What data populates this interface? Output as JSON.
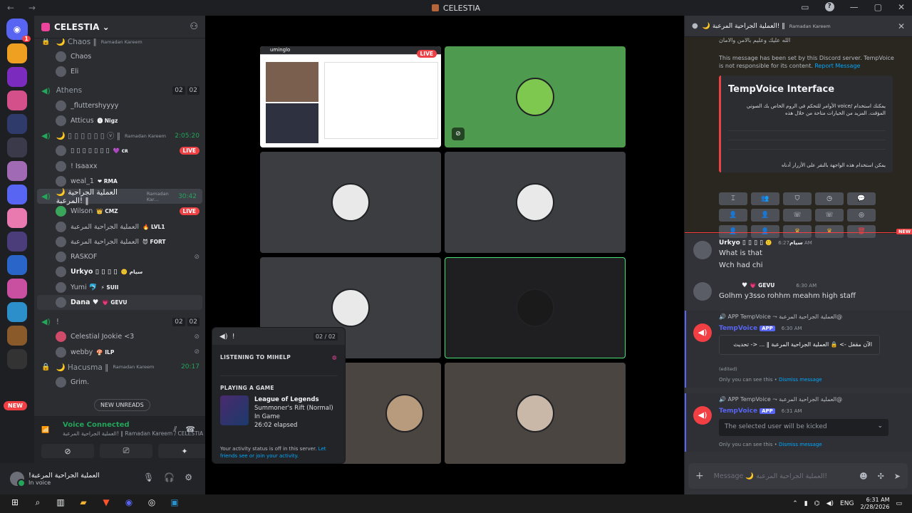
{
  "titlebar": {
    "title": "CELESTIA",
    "nav": "← →"
  },
  "rail": {
    "home_badge": "1",
    "new_label": "NEW"
  },
  "sidebar": {
    "server_name": "CELESTIA ⌄",
    "channels": [
      {
        "name": "🌙 Chaos ‖",
        "sub": "Ramadan Kareem",
        "members": [
          {
            "name": "Chaos",
            "tag": ""
          },
          {
            "name": "Eli",
            "tag": ""
          }
        ]
      },
      {
        "name": "Athens",
        "count": [
          "02",
          "02"
        ],
        "members": [
          {
            "name": "_fluttershyyyy",
            "tag": ""
          },
          {
            "name": "Atticus",
            "tag": "🅨 Nigz"
          }
        ]
      },
      {
        "name": "🌙 ▯ ▯ ▯ ▯ ▯ ▯ ⓥ ‖",
        "sub": "Ramadan Kareem",
        "time": "2:05:20",
        "members": [
          {
            "name": "▯ ▯ ▯ ▯ ▯ ▯ ▯",
            "tag": "💜 ᴄʀ",
            "live": "LIVE"
          },
          {
            "name": "! Isaaxx",
            "tag": ""
          },
          {
            "name": "weal_1",
            "tag": "❤ RMA"
          }
        ]
      },
      {
        "name": "🌙 العملية الجراحية المرعبة! ‖",
        "sub": "Ramadan Kar...",
        "time": "30:42",
        "members": [
          {
            "name": "Wilson",
            "tag": "👑 CMZ",
            "live": "LIVE"
          },
          {
            "name": "العملية الجراحية المرعبة",
            "tag": "🔥 LVL1"
          },
          {
            "name": "العملية الجراحية المرعبة",
            "tag": "😈 FORT"
          },
          {
            "name": "RASKOF",
            "tag": ""
          },
          {
            "name": "Urkyo ▯ ▯ ▯ ▯",
            "tag": "🙂 سيام"
          },
          {
            "name": "Yumi 🐬",
            "tag": "⚡ SUII"
          },
          {
            "name": "Dana ♥",
            "tag": "💗 GEVU"
          }
        ]
      },
      {
        "name": "!",
        "count": [
          "02",
          "02"
        ],
        "members": [
          {
            "name": "Celestial Jookie <3",
            "tag": ""
          },
          {
            "name": "webby",
            "tag": "🍄 ILP"
          }
        ]
      },
      {
        "name": "🌙 Hacusma ‖",
        "sub": "Ramadan Kareem",
        "time": "20:17",
        "members": [
          {
            "name": "Grim.",
            "tag": ""
          }
        ]
      }
    ],
    "new_unreads": "NEW UNREADS"
  },
  "voice_panel": {
    "status": "Voice Connected",
    "channel": "العملية الجراحية المرعبة! ‖ Ramadan Kareem / CELESTIA"
  },
  "userbar": {
    "name": "!العملية الجراحية المرعبة",
    "status": "In voice"
  },
  "stage": {
    "screen_brand": "uminglo",
    "live_label": "LIVE"
  },
  "popout": {
    "title": "!",
    "count": "02 / 02",
    "listening": "LISTENING TO MIHELP",
    "playing": "PLAYING A GAME",
    "game_name": "League of Legends",
    "game_detail": "Summoner's Rift (Normal)",
    "game_state": "In Game",
    "game_elapsed": "26:02 elapsed",
    "note": "Your activity status is off in this server.",
    "note_link": "Let friends see or join your activity."
  },
  "chat": {
    "header": "🌙 العملية الجراحية المرعبة! ‖",
    "header_sub": "Ramadan Kareem",
    "top_line": "الله عليك وعليم بالامن والامان",
    "notice": "This message has been set by this Discord server. TempVoice is not responsible for its content.",
    "notice_link": "Report Message",
    "embed_title": "TempVoice Interface",
    "embed_body": "يمكنك استخدام /voice الأوامر للتحكم في الروم الخاص بك الصوتي المؤقت. المزيد من الخيارات متاحة من خلال هذه",
    "embed_footer": "يمكن استخدام هذه الواجهة بالنقر على الأزرار أدناه",
    "new_label": "NEW",
    "messages": [
      {
        "author": "Urkyo ▯ ▯ ▯ ▯",
        "tag": "🙂 سيام",
        "time": "6:27 AM",
        "lines": [
          "What is that",
          "Wch had chi"
        ]
      },
      {
        "author": "♥",
        "tag": "💗 GEVU",
        "time": "6:30 AM",
        "lines": [
          "Golhm y3sso rohhm meahm high staff"
        ]
      }
    ],
    "eph1": {
      "reply": "🔊 APP TempVoice ⤳ العملية الجراحية المرعبة@",
      "author": "TempVoice",
      "app": "APP",
      "time": "6:30 AM",
      "box": "الآن مقفل -> 🔒 العملية الجراحية المرعبة ‖ ... <- تحديث",
      "edited": "(edited)",
      "only": "Only you can see this •",
      "dismiss": "Dismiss message"
    },
    "eph2": {
      "reply": "🔊 APP TempVoice ⤳ العملية الجراحية المرعبة@",
      "author": "TempVoice",
      "app": "APP",
      "time": "6:31 AM",
      "select": "The selected user will be kicked",
      "only": "Only you can see this •",
      "dismiss": "Dismiss message"
    },
    "composer_placeholder": "Message 🌙 العملية الجراحية المرعبة! ‖ R..."
  },
  "taskbar": {
    "lang": "ENG",
    "time": "6:31 AM",
    "date": "2/28/2026"
  },
  "colors": {
    "accent": "#5865f2",
    "online": "#23a55a",
    "live": "#ed4245",
    "selected_tile": "#4ee07a"
  }
}
